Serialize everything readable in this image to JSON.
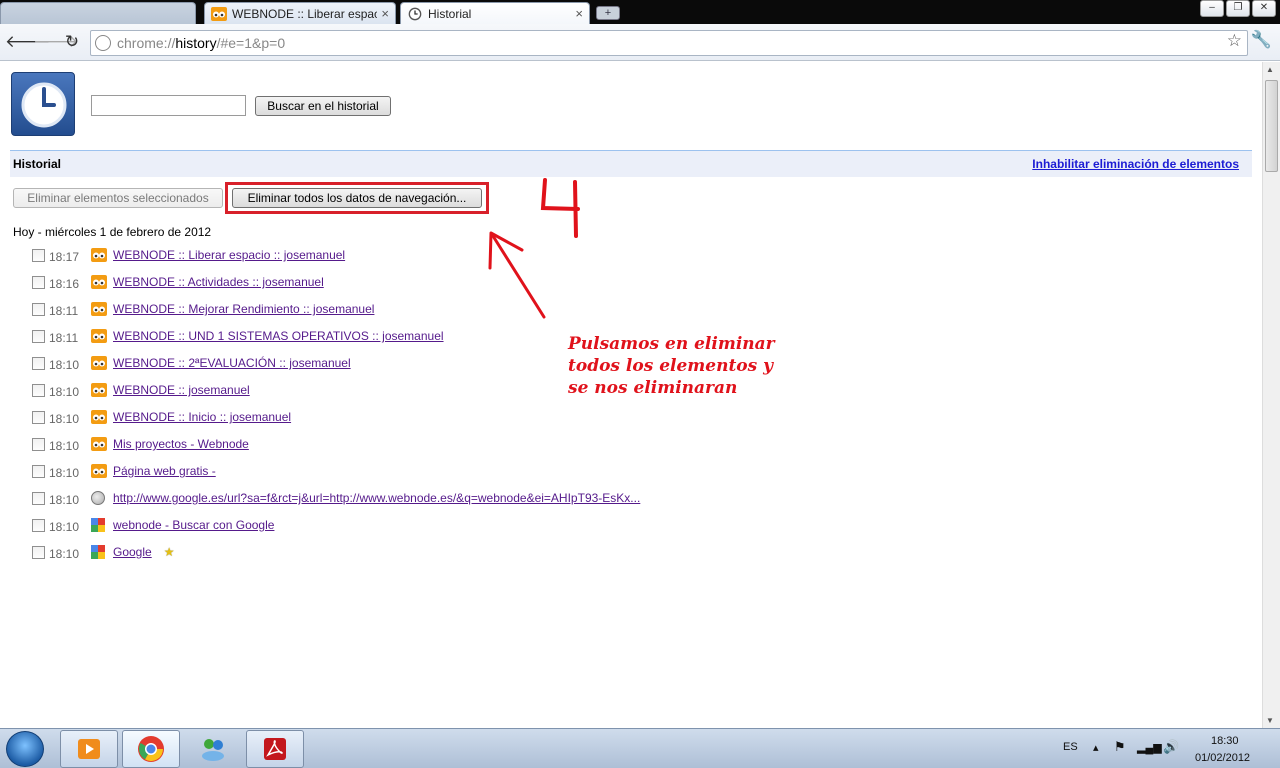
{
  "tabs": [
    {
      "title": "",
      "active": false
    },
    {
      "title": "WEBNODE :: Liberar espacio",
      "active": false
    },
    {
      "title": "Historial",
      "active": true
    }
  ],
  "toolbar": {
    "url_scheme": "chrome://",
    "url_host": "history",
    "url_path": "/#e=1&p=0"
  },
  "history_page": {
    "search_placeholder": "",
    "search_button": "Buscar en el historial",
    "section_title": "Historial",
    "disable_delete_link": "Inhabilitar eliminación de elementos",
    "delete_selected_button": "Eliminar elementos seleccionados",
    "clear_all_button": "Eliminar todos los datos de navegación...",
    "day_heading": "Hoy - miércoles 1 de febrero de 2012",
    "entries": [
      {
        "time": "18:17",
        "title": "WEBNODE :: Liberar espacio :: josemanuel",
        "icon": "webnode-icon",
        "starred": false
      },
      {
        "time": "18:16",
        "title": "WEBNODE :: Actividades :: josemanuel",
        "icon": "webnode-icon",
        "starred": false
      },
      {
        "time": "18:11",
        "title": "WEBNODE :: Mejorar Rendimiento :: josemanuel",
        "icon": "webnode-icon",
        "starred": false
      },
      {
        "time": "18:11",
        "title": "WEBNODE :: UND 1 SISTEMAS OPERATIVOS :: josemanuel",
        "icon": "webnode-icon",
        "starred": false
      },
      {
        "time": "18:10",
        "title": "WEBNODE :: 2ªEVALUACIÓN :: josemanuel",
        "icon": "webnode-icon",
        "starred": false
      },
      {
        "time": "18:10",
        "title": "WEBNODE :: josemanuel",
        "icon": "webnode-icon",
        "starred": false
      },
      {
        "time": "18:10",
        "title": "WEBNODE :: Inicio :: josemanuel",
        "icon": "webnode-icon",
        "starred": false
      },
      {
        "time": "18:10",
        "title": "Mis proyectos - Webnode",
        "icon": "webnode-icon",
        "starred": false
      },
      {
        "time": "18:10",
        "title": "Página web gratis -",
        "icon": "webnode-icon",
        "starred": false
      },
      {
        "time": "18:10",
        "title": "http://www.google.es/url?sa=f&rct=j&url=http://www.webnode.es/&q=webnode&ei=AHIpT93-EsKx...",
        "icon": "globe-icon",
        "starred": false
      },
      {
        "time": "18:10",
        "title": "webnode - Buscar con Google",
        "icon": "google-icon",
        "starred": false
      },
      {
        "time": "18:10",
        "title": "Google",
        "icon": "google-icon",
        "starred": true
      }
    ]
  },
  "annotation": {
    "step_number": "4",
    "lines": [
      "Pulsamos en eliminar",
      "todos los elementos y",
      "se nos eliminaran"
    ],
    "color": "#e0121b"
  },
  "taskbar": {
    "language": "ES",
    "time": "18:30",
    "date": "01/02/2012"
  }
}
